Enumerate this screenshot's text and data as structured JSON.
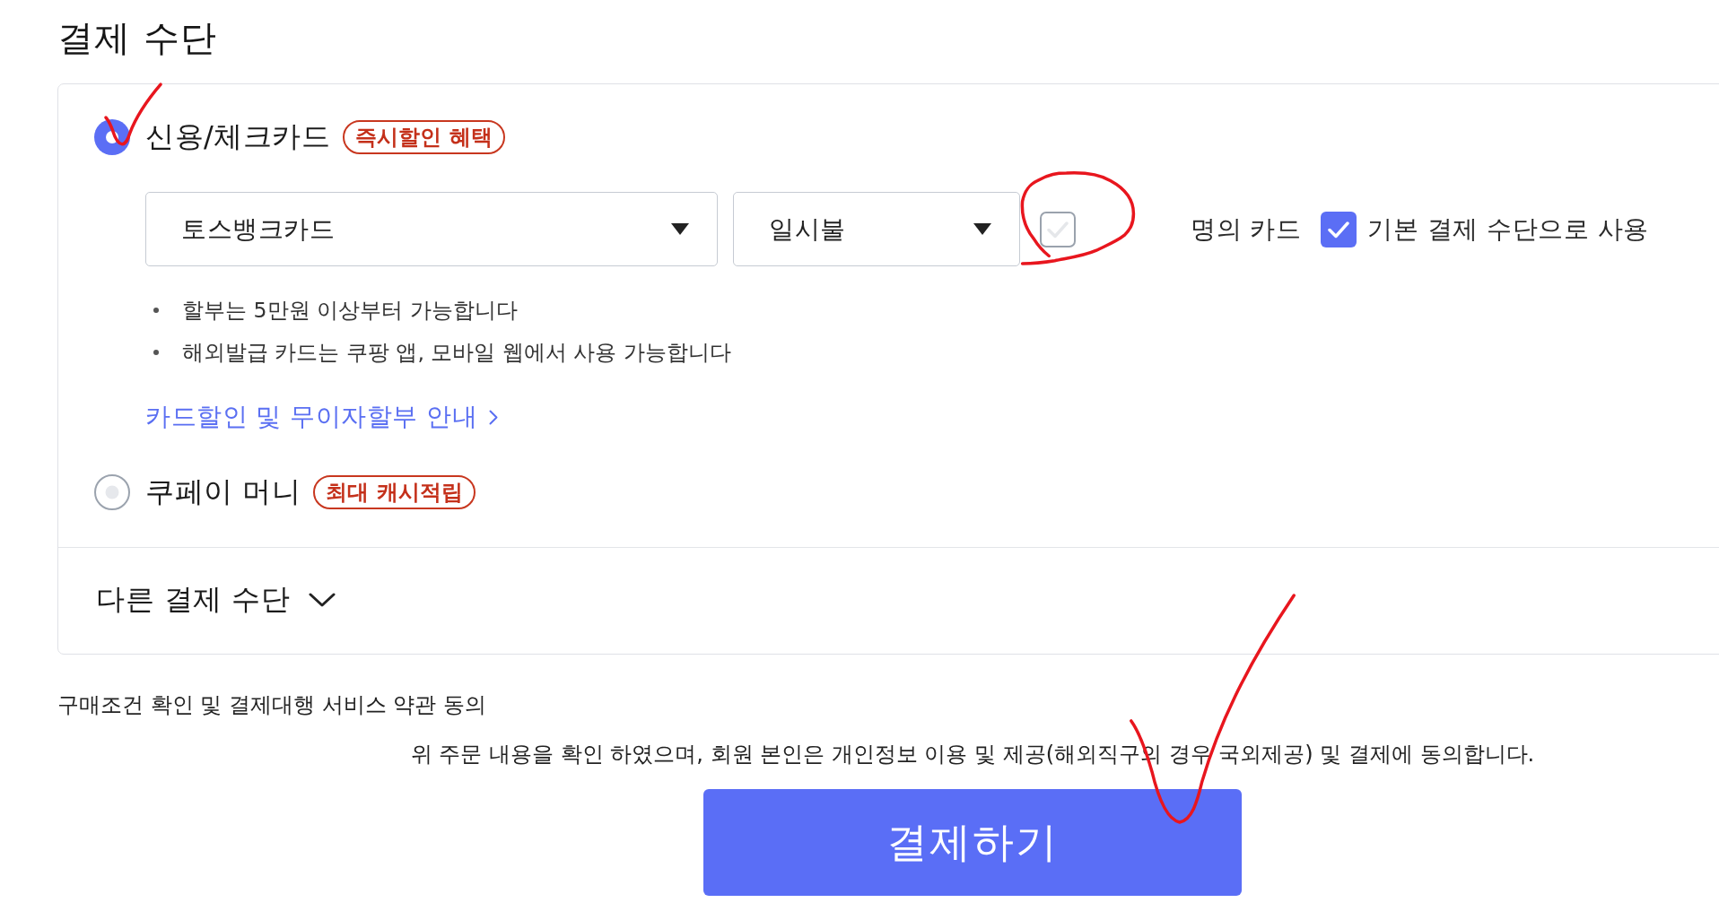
{
  "section_title": "결제 수단",
  "payment_methods": [
    {
      "label": "신용/체크카드",
      "badge": "즉시할인 혜택",
      "selected": true,
      "hand_mark": {
        "kind": "check"
      },
      "dropdowns": [
        {
          "value": "토스뱅크카드"
        },
        {
          "value": "일시불"
        }
      ],
      "options": [
        {
          "label": "명의 카드",
          "checked": false,
          "hand_mark": {
            "kind": "circle"
          }
        },
        {
          "label": "기본 결제 수단으로 사용",
          "checked": true
        }
      ],
      "notes": [
        "할부는 5만원 이상부터 가능합니다",
        "해외발급 카드는 쿠팡 앱, 모바일 웹에서 사용 가능합니다"
      ],
      "link": "카드할인 및 무이자할부 안내"
    },
    {
      "label": "쿠페이 머니",
      "badge": "최대 캐시적립",
      "selected": false
    }
  ],
  "other_methods": {
    "label": "다른 결제 수단",
    "expanded": false
  },
  "agreement": {
    "title": "구매조건 확인 및 결제대행 서비스 약관 동의",
    "text": "위 주문 내용을 확인 하였으며, 회원 본인은 개인정보 이용 및 제공(해외직구의 경우 국외제공) 및 결제에 동의합니다."
  },
  "pay_button": {
    "label": "결제하기",
    "hand_mark": {
      "kind": "check"
    }
  }
}
